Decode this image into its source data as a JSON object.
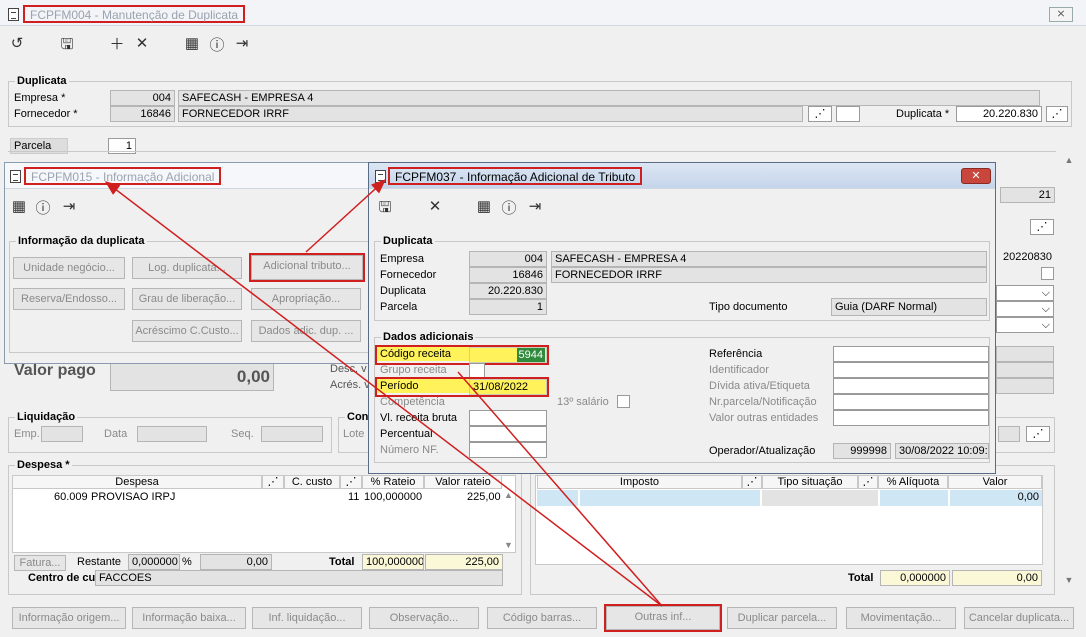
{
  "main": {
    "title": "FCPFM004 - Manutenção de Duplicata",
    "dup": {
      "section": "Duplicata",
      "empresa_label": "Empresa *",
      "empresa_code": "004",
      "empresa_name": "SAFECASH -  EMPRESA 4",
      "fornecedor_label": "Fornecedor *",
      "fornecedor_code": "16846",
      "fornecedor_name": "FORNECEDOR IRRF",
      "duplicata_label": "Duplicata *",
      "duplicata_value": "20.220.830"
    },
    "parcela": {
      "section": "Parcela",
      "value": "1",
      "r21": "21",
      "r_date": "20220830"
    },
    "valor_pago": {
      "label": "Valor pago",
      "value": "0,00",
      "desc": "Desc. v",
      "acres": "Acrés. v"
    },
    "liq": {
      "section": "Liquidação",
      "emp": "Emp.",
      "data": "Data",
      "seq": "Seq.",
      "cont": "Con",
      "lote": "Lote"
    },
    "despesa": {
      "section": "Despesa *",
      "h_despesa": "Despesa",
      "h_ccusto": "C. custo",
      "h_rateio": "% Rateio",
      "h_valor": "Valor rateio",
      "row_code": "60.009",
      "row_name": "PROVISAO IRPJ",
      "row_cc": "11",
      "row_pct": "100,000000",
      "row_val": "225,00",
      "fatura": "Fatura...",
      "restante": "Restante",
      "rest_val": "0,000000",
      "pct": "%",
      "rest_amt": "0,00",
      "total": "Total",
      "total_pct": "100,000000",
      "total_val": "225,00",
      "centro_label": "Centro de custo:",
      "centro_value": "FACCOES"
    },
    "imposto": {
      "h_imposto": "Imposto",
      "h_tipo": "Tipo situação",
      "h_aliq": "% Alíquota",
      "h_valor": "Valor",
      "row_val": "0,00",
      "total": "Total",
      "total_pct": "0,000000",
      "total_val": "0,00"
    },
    "bottom": [
      "Informação origem...",
      "Informação baixa...",
      "Inf. liquidação...",
      "Observação...",
      "Código barras...",
      "Outras inf...",
      "Duplicar parcela...",
      "Movimentação...",
      "Cancelar duplicata..."
    ]
  },
  "w15": {
    "title": "FCPFM015 - Informação Adicional",
    "section": "Informação da duplicata",
    "buttons": [
      "Unidade negócio...",
      "Log. duplicata...",
      "Adicional tributo...",
      "Reserva/Endosso...",
      "Grau de liberação...",
      "Apropriação...",
      "Acréscimo C.Custo...",
      "Dados adic. dup. ..."
    ]
  },
  "w37": {
    "title": "FCPFM037 - Informação Adicional de Tributo",
    "dup": {
      "section": "Duplicata",
      "empresa": "Empresa",
      "empresa_code": "004",
      "empresa_name": "SAFECASH -  EMPRESA 4",
      "fornecedor": "Fornecedor",
      "fornecedor_code": "16846",
      "fornecedor_name": "FORNECEDOR IRRF",
      "duplicata": "Duplicata",
      "duplicata_value": "20.220.830",
      "parcela": "Parcela",
      "parcela_value": "1",
      "tipo_label": "Tipo documento",
      "tipo_value": "Guia (DARF Normal)"
    },
    "dados": {
      "section": "Dados adicionais",
      "codigo": "Código receita",
      "codigo_value": "5944",
      "grupo": "Grupo receita",
      "periodo": "Período",
      "periodo_value": "31/08/2022",
      "competencia": "Competência",
      "salario": "13º salário",
      "vl_receita": "Vl. receita bruta",
      "percentual": "Percentual",
      "numero_nf": "Número NF.",
      "referencia": "Referência",
      "identificador": "Identificador",
      "divida": "Dívida ativa/Etiqueta",
      "nr_parcela": "Nr.parcela/Notificação",
      "valor_outras": "Valor outras entidades",
      "operador": "Operador/Atualização",
      "operador_code": "999998",
      "operador_date": "30/08/2022 10:09:"
    }
  }
}
